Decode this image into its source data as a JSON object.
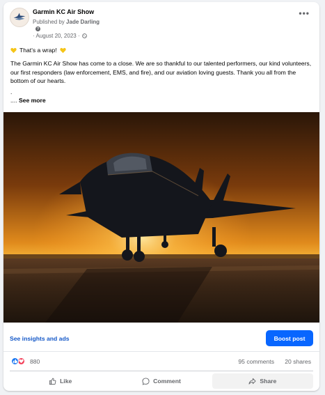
{
  "post": {
    "page_name": "Garmin KC Air Show",
    "published_prefix": "Published by",
    "published_by": "Jade Darling",
    "help_icon_text": "?",
    "date": "· August 20, 2023 ·",
    "more_label": "•••",
    "headline": "That's a wrap!",
    "body": "The Garmin KC Air Show has come to a close. We are so thankful to our talented performers, our kind volunteers, our first responders (law enforcement, EMS, and fire), and our aviation loving guests. Thank you all from the bottom of our hearts.",
    "dot_line": ".",
    "ellipsis": "....",
    "see_more": "See more"
  },
  "insights": {
    "link_label": "See insights and ads",
    "boost_label": "Boost post"
  },
  "stats": {
    "reactions": "880",
    "comments": "95 comments",
    "shares": "20 shares"
  },
  "actions": {
    "like": "Like",
    "comment": "Comment",
    "share": "Share"
  },
  "icons": {
    "avatar": "airshow-logo-icon",
    "globe": "globe-icon",
    "heart": "yellow-heart-icon",
    "like": "thumbs-up-icon",
    "love": "heart-icon",
    "comment": "comment-icon",
    "share": "share-icon"
  },
  "colors": {
    "brand_blue": "#0866ff",
    "link_blue": "#1458c8",
    "heart_yellow": "#f5c518",
    "love_red": "#f33e58",
    "like_blue": "#1877f2",
    "muted_text": "#65676b"
  }
}
